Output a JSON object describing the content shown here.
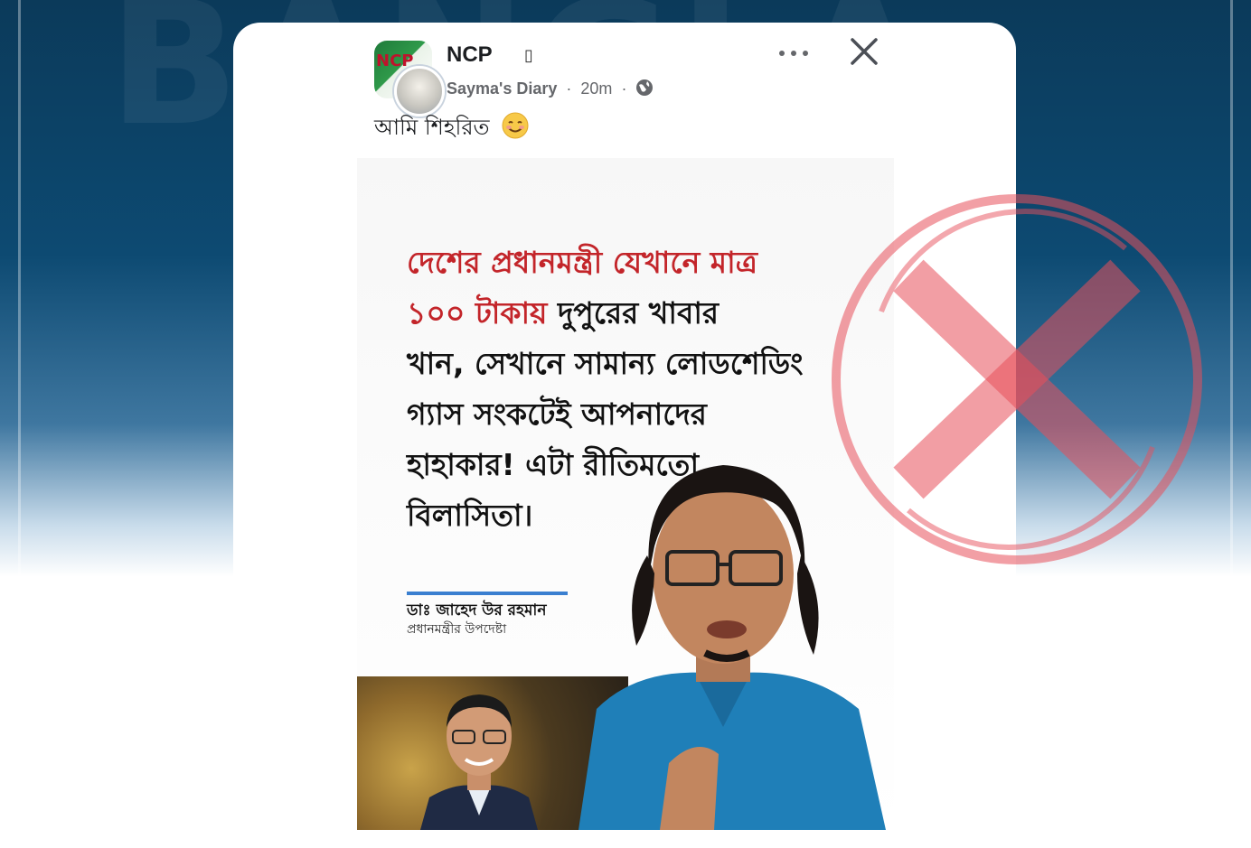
{
  "post": {
    "page_name": "NCP",
    "name_glyph": "▯",
    "author": "Sayma's Diary",
    "time": "20m",
    "separator": "·",
    "text": "আমি শিহরিত"
  },
  "image": {
    "quote_red_line1": "দেশের প্রধানমন্ত্রী যেখানে মাত্র",
    "quote_red_line2": "১০০ টাকায়",
    "quote_black_line2": " দুপুরের খাবার",
    "quote_black_line3": "খান, সেখানে সামান্য লোডশেডিং",
    "quote_black_line4": "গ্যাস সংকটেই আপনাদের",
    "quote_black_line5": "হাহাকার! এটা রীতিমতো",
    "quote_black_line6": "বিলাসিতা।",
    "credit_name": "ডাঃ জাহেদ উর রহমান",
    "credit_role": "প্রধানমন্ত্রীর উপদেষ্টা"
  },
  "icons": {
    "more": "more-options-icon",
    "close": "close-icon",
    "audience": "globe-icon",
    "emoji": "smiling-face-emoji",
    "stamp": "fake-cross-stamp"
  },
  "colors": {
    "quote_red": "#c3252a",
    "stamp_red": "#e8505b",
    "background_blue": "#0d4a72"
  }
}
